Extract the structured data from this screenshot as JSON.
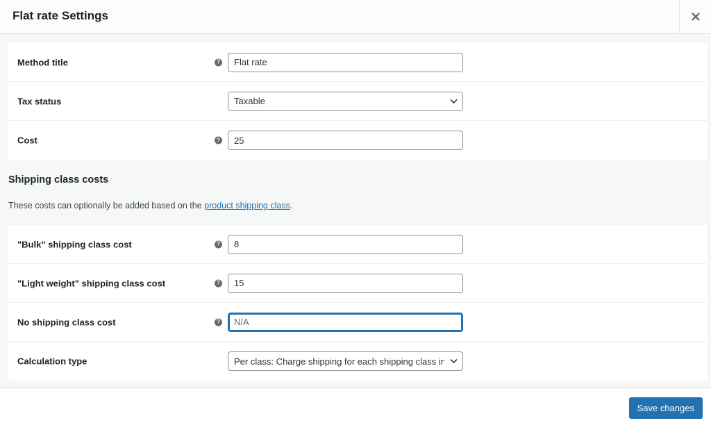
{
  "header": {
    "title": "Flat rate Settings",
    "close_icon": "close-icon"
  },
  "general": {
    "method_title": {
      "label": "Method title",
      "value": "Flat rate",
      "has_help": true
    },
    "tax_status": {
      "label": "Tax status",
      "value": "Taxable"
    },
    "cost": {
      "label": "Cost",
      "value": "25",
      "has_help": true
    }
  },
  "shipping_class_section": {
    "title": "Shipping class costs",
    "description_prefix": "These costs can optionally be added based on the ",
    "link_text": "product shipping class",
    "description_suffix": "."
  },
  "class_costs": {
    "bulk": {
      "label": "\"Bulk\" shipping class cost",
      "value": "8"
    },
    "light_weight": {
      "label": "\"Light weight\" shipping class cost",
      "value": "15"
    },
    "no_class": {
      "label": "No shipping class cost",
      "value": "",
      "placeholder": "N/A"
    },
    "calculation_type": {
      "label": "Calculation type",
      "value": "Per class: Charge shipping for each shipping class individually"
    }
  },
  "footer": {
    "save_label": "Save changes"
  },
  "colors": {
    "accent": "#2271b1",
    "help_icon": "#646970",
    "background": "#f6f7f7"
  }
}
